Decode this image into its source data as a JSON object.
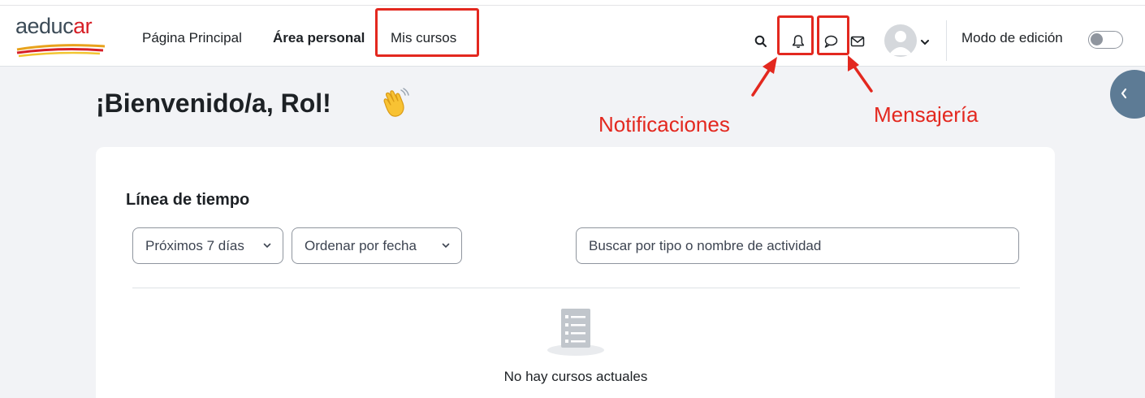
{
  "brand": {
    "logo_part1": "aeduc",
    "logo_part2": "ar",
    "accent": "#d72027",
    "dark": "#3c4b57"
  },
  "nav": {
    "home": "Página Principal",
    "personal_area": "Área personal",
    "my_courses": "Mis cursos"
  },
  "toolbar": {
    "icons": [
      "search-icon",
      "bell-icon",
      "chat-icon",
      "mail-icon",
      "user-avatar",
      "chevron-down-icon"
    ],
    "edit_mode_label": "Modo de edición",
    "edit_mode_on": false
  },
  "page": {
    "welcome": "¡Bienvenido/a, Rol!",
    "welcome_emoji": "waving-hand"
  },
  "annotations": {
    "notifications": "Notificaciones",
    "messaging": "Mensajería",
    "color": "#e3281f"
  },
  "timeline": {
    "title": "Línea de tiempo",
    "filter_selected": "Próximos 7 días",
    "sort_selected": "Ordenar por fecha",
    "search_placeholder": "Buscar por tipo o nombre de actividad",
    "empty_message": "No hay cursos actuales"
  },
  "colors": {
    "page_bg": "#f2f3f6",
    "drawer_toggle": "#5d7b95"
  }
}
